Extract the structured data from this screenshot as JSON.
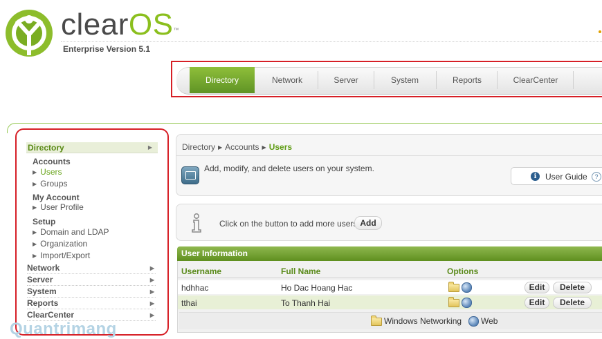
{
  "brand": {
    "name_prefix": "clear",
    "name_suffix": "OS",
    "trademark": "™",
    "edition": "Enterprise Version 5.1"
  },
  "nav": {
    "tabs": [
      "Directory",
      "Network",
      "Server",
      "System",
      "Reports",
      "ClearCenter"
    ],
    "active": "Directory"
  },
  "sidebar": {
    "directory": "Directory",
    "sections": [
      {
        "title": "Accounts",
        "items": [
          "Users",
          "Groups"
        ]
      },
      {
        "title": "My Account",
        "items": [
          "User Profile"
        ]
      },
      {
        "title": "Setup",
        "items": [
          "Domain and LDAP",
          "Organization",
          "Import/Export"
        ]
      }
    ],
    "active_item": "Users",
    "top_menus": [
      "Network",
      "Server",
      "System",
      "Reports",
      "ClearCenter"
    ]
  },
  "breadcrumb": [
    "Directory",
    "Accounts",
    "Users"
  ],
  "summary": {
    "description": "Add, modify, and delete users on your system.",
    "guide_label": "User Guide"
  },
  "hint": {
    "text": "Click on the button to add more users",
    "add_label": "Add"
  },
  "user_info": {
    "title": "User Information",
    "columns": [
      "Username",
      "Full Name",
      "Options"
    ],
    "rows": [
      {
        "username": "hdhhac",
        "full_name": "Ho Dac Hoang Hac"
      },
      {
        "username": "tthai",
        "full_name": "To Thanh Hai"
      }
    ],
    "edit_label": "Edit",
    "delete_label": "Delete",
    "legend": {
      "folder": "Windows Networking",
      "web": "Web"
    }
  },
  "watermark": "Quantrimang",
  "colors": {
    "accent_green": "#6aa51e",
    "highlight_red": "#d61f26"
  }
}
